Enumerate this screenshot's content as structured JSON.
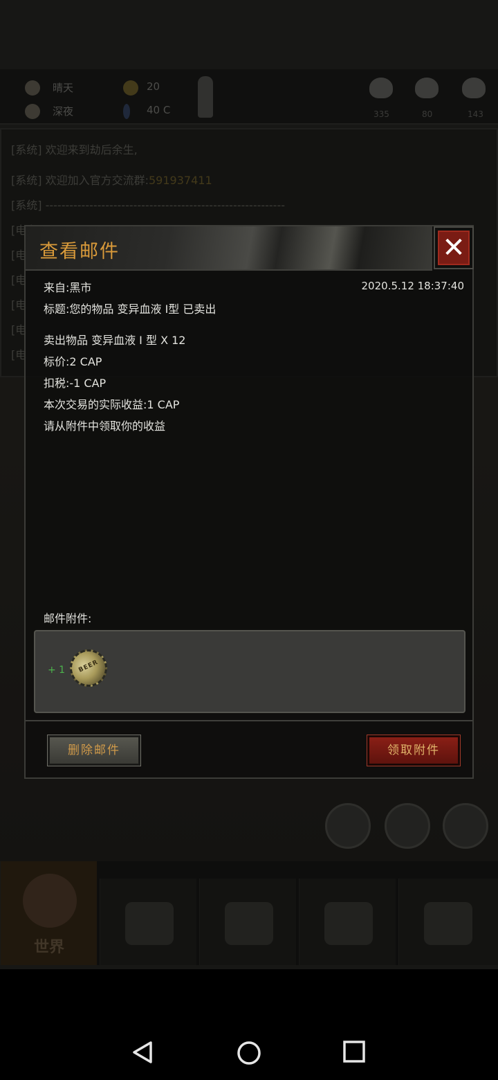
{
  "status": {
    "weather": "晴天",
    "time_of_day": "深夜",
    "radiation": "20",
    "temperature": "40 C",
    "vitals": [
      "335",
      "80",
      "143"
    ]
  },
  "chat": {
    "lines": [
      {
        "tag": "[系统]",
        "text": "欢迎来到劫后余生,"
      },
      {
        "tag": "[系统]",
        "text": "欢迎加入官方交流群:",
        "highlight": "591937411"
      },
      {
        "tag": "[系统]",
        "text": "------------------------------------------------------------"
      },
      {
        "tag": "[电台]",
        "text": ""
      },
      {
        "tag": "[电",
        "text": ""
      },
      {
        "tag": "[电",
        "text": ""
      },
      {
        "tag": "[电",
        "text": ""
      },
      {
        "tag": "[电",
        "text": ""
      },
      {
        "tag": "[电",
        "text": ""
      }
    ]
  },
  "dialog": {
    "title": "查看邮件",
    "close_icon": "close-icon",
    "from": "来自:黑市",
    "date": "2020.5.12 18:37:40",
    "subject": "标题:您的物品 变异血液 I型 已卖出",
    "body_lines": [
      "卖出物品 变异血液 I 型 X 12",
      "标价:2 CAP",
      "扣税:-1 CAP",
      "本次交易的实际收益:1 CAP",
      "请从附件中领取你的收益"
    ],
    "attachments_label": "邮件附件:",
    "attachment": {
      "qty": "+ 1",
      "icon": "bottle-cap-icon",
      "coin_text": "BEER"
    },
    "delete_label": "删除邮件",
    "claim_label": "领取附件"
  },
  "nav": {
    "tabs": [
      {
        "label": "世界",
        "icon": "globe-icon"
      },
      {
        "label": "",
        "icon": "briefcase-icon"
      },
      {
        "label": "",
        "icon": "head-gear-icon"
      },
      {
        "label": "",
        "icon": "trade-icon"
      },
      {
        "label": "",
        "icon": "cart-icon"
      }
    ]
  },
  "colors": {
    "title": "#d99a3a",
    "claim_button": "#7a1c14",
    "attachment_qty": "#4cb34c"
  }
}
